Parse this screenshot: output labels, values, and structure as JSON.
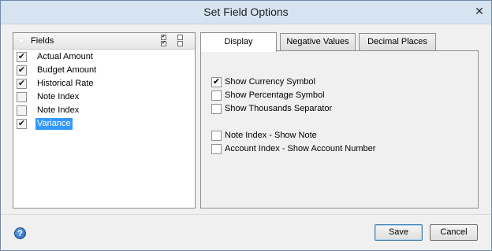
{
  "window": {
    "title": "Set Field Options",
    "close_glyph": "✕"
  },
  "fields": {
    "header_label": "Fields",
    "items": [
      {
        "label": "Actual Amount",
        "checked": true
      },
      {
        "label": "Budget Amount",
        "checked": true
      },
      {
        "label": "Historical Rate",
        "checked": true
      },
      {
        "label": "Note Index",
        "checked": false
      },
      {
        "label": "Note Index",
        "checked": false
      },
      {
        "label": "Variance",
        "checked": true,
        "selected": true
      }
    ]
  },
  "tabs": [
    {
      "label": "Display",
      "active": true
    },
    {
      "label": "Negative Values",
      "active": false
    },
    {
      "label": "Decimal Places",
      "active": false
    }
  ],
  "display_options": [
    {
      "label": "Show Currency Symbol",
      "checked": true
    },
    {
      "label": "Show Percentage Symbol",
      "checked": false
    },
    {
      "label": "Show Thousands Separator",
      "checked": false
    },
    {
      "label": "Note Index - Show Note",
      "checked": false
    },
    {
      "label": "Account Index - Show Account Number",
      "checked": false
    }
  ],
  "footer": {
    "help_glyph": "?",
    "save_label": "Save",
    "cancel_label": "Cancel"
  },
  "check_glyph": "✔"
}
